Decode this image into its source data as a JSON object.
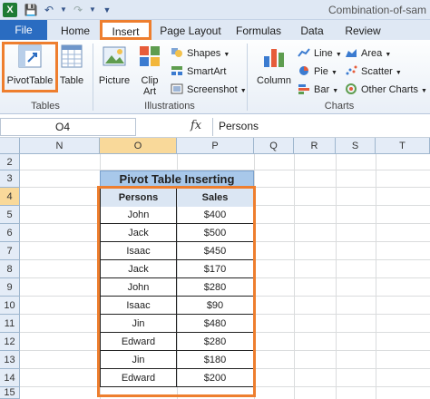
{
  "titlebar": {
    "app_icon": "X",
    "save_icon": "floppy-icon",
    "document_title": "Combination-of-sam"
  },
  "tabs": [
    "File",
    "Home",
    "Insert",
    "Page Layout",
    "Formulas",
    "Data",
    "Review"
  ],
  "ribbon": {
    "tables": {
      "pivot": "PivotTable",
      "table": "Table",
      "label": "Tables"
    },
    "illustrations": {
      "picture": "Picture",
      "clip_art_1": "Clip",
      "clip_art_2": "Art",
      "shapes": "Shapes",
      "smartart": "SmartArt",
      "screenshot": "Screenshot",
      "label": "Illustrations"
    },
    "charts": {
      "column": "Column",
      "line": "Line",
      "pie": "Pie",
      "bar": "Bar",
      "area": "Area",
      "scatter": "Scatter",
      "other": "Other Charts",
      "label": "Charts"
    }
  },
  "formula_bar": {
    "name_box": "O4",
    "fx": "fx",
    "content": "Persons"
  },
  "columns": [
    "N",
    "O",
    "P",
    "Q",
    "R",
    "S",
    "T"
  ],
  "rows": [
    "2",
    "3",
    "4",
    "5",
    "6",
    "7",
    "8",
    "9",
    "10",
    "11",
    "12",
    "13",
    "14",
    "15"
  ],
  "sheet": {
    "title": "Pivot Table Inserting",
    "headers": [
      "Persons",
      "Sales"
    ],
    "data": [
      [
        "John",
        "$400"
      ],
      [
        "Jack",
        "$500"
      ],
      [
        "Isaac",
        "$450"
      ],
      [
        "Jack",
        "$170"
      ],
      [
        "John",
        "$280"
      ],
      [
        "Isaac",
        "$90"
      ],
      [
        "Jin",
        "$480"
      ],
      [
        "Edward",
        "$280"
      ],
      [
        "Jin",
        "$180"
      ],
      [
        "Edward",
        "$200"
      ]
    ]
  },
  "colors": {
    "highlight": "#ee7e2e",
    "file_tab": "#2a6cc1",
    "title_fill": "#a8c8ea"
  }
}
